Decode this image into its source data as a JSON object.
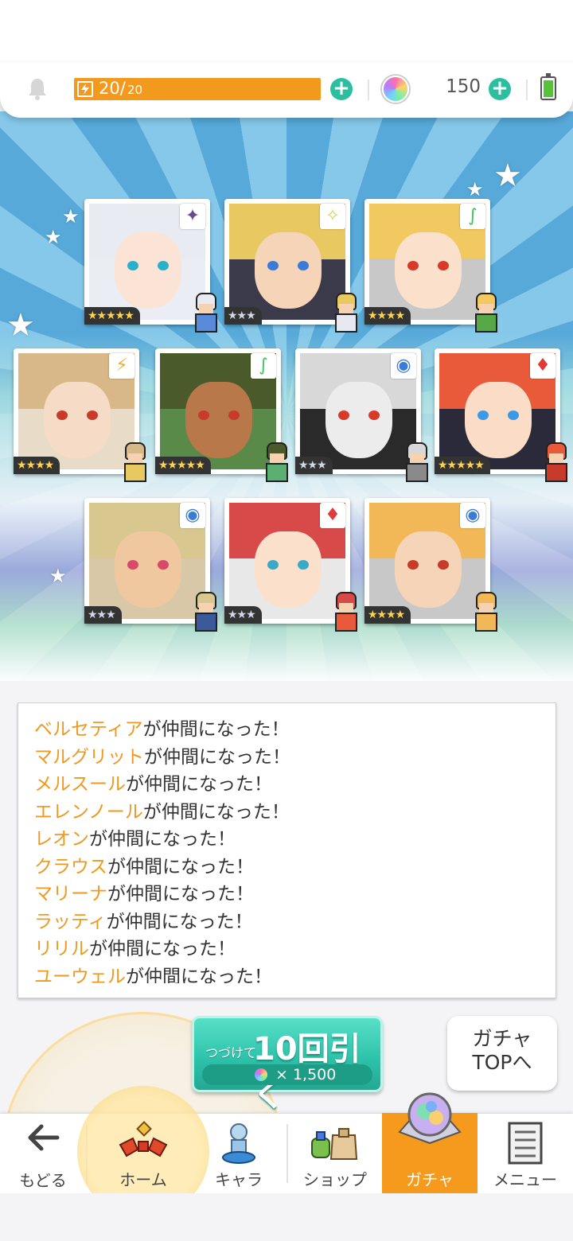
{
  "header": {
    "stamina_current": "20/",
    "stamina_max": "20",
    "gem_count": "150"
  },
  "results": {
    "cards": [
      {
        "rarity": "★★★★★",
        "rarity_tier": "gold-rainbow",
        "element": "dark",
        "element_symbol": "✦",
        "element_color": "#6b4a8a"
      },
      {
        "rarity": "★★★",
        "rarity_tier": "silver",
        "element": "light",
        "element_symbol": "✧",
        "element_color": "#d8d060"
      },
      {
        "rarity": "★★★★",
        "rarity_tier": "gold",
        "element": "wind",
        "element_symbol": "∫",
        "element_color": "#3cc05a"
      },
      {
        "rarity": "★★★★",
        "rarity_tier": "gold",
        "element": "thunder",
        "element_symbol": "⚡",
        "element_color": "#f0b020"
      },
      {
        "rarity": "★★★★★",
        "rarity_tier": "gold-rainbow",
        "element": "wind",
        "element_symbol": "∫",
        "element_color": "#3cc05a"
      },
      {
        "rarity": "★★★",
        "rarity_tier": "silver",
        "element": "water",
        "element_symbol": "◉",
        "element_color": "#3a7ad8"
      },
      {
        "rarity": "★★★★★",
        "rarity_tier": "gold-rainbow",
        "element": "fire",
        "element_symbol": "♦",
        "element_color": "#e03a3a"
      },
      {
        "rarity": "★★★",
        "rarity_tier": "silver",
        "element": "water",
        "element_symbol": "◉",
        "element_color": "#3a7ad8"
      },
      {
        "rarity": "★★★",
        "rarity_tier": "silver",
        "element": "fire",
        "element_symbol": "♦",
        "element_color": "#e03a3a"
      },
      {
        "rarity": "★★★★",
        "rarity_tier": "gold",
        "element": "water",
        "element_symbol": "◉",
        "element_color": "#3a7ad8"
      }
    ]
  },
  "log": {
    "suffix": "が仲間になった！",
    "names": [
      "ベルセティア",
      "マルグリット",
      "メルスール",
      "エレンノール",
      "レオン",
      "クラウス",
      "マリーナ",
      "ラッティ",
      "リリル",
      "ユーウェル"
    ]
  },
  "actions": {
    "pull_prefix": "つづけて",
    "pull_label": "10回引く",
    "pull_cost": "× 1,500",
    "top_line1": "ガチャ",
    "top_line2": "TOPへ"
  },
  "nav": {
    "back": "もどる",
    "home": "ホーム",
    "chara": "キャラ",
    "shop": "ショップ",
    "gacha": "ガチャ",
    "menu": "メニュー",
    "active": "gacha"
  },
  "colors": {
    "accent_orange": "#f59a1c",
    "teal": "#2bbfa0",
    "name_orange": "#ef9a1f"
  }
}
